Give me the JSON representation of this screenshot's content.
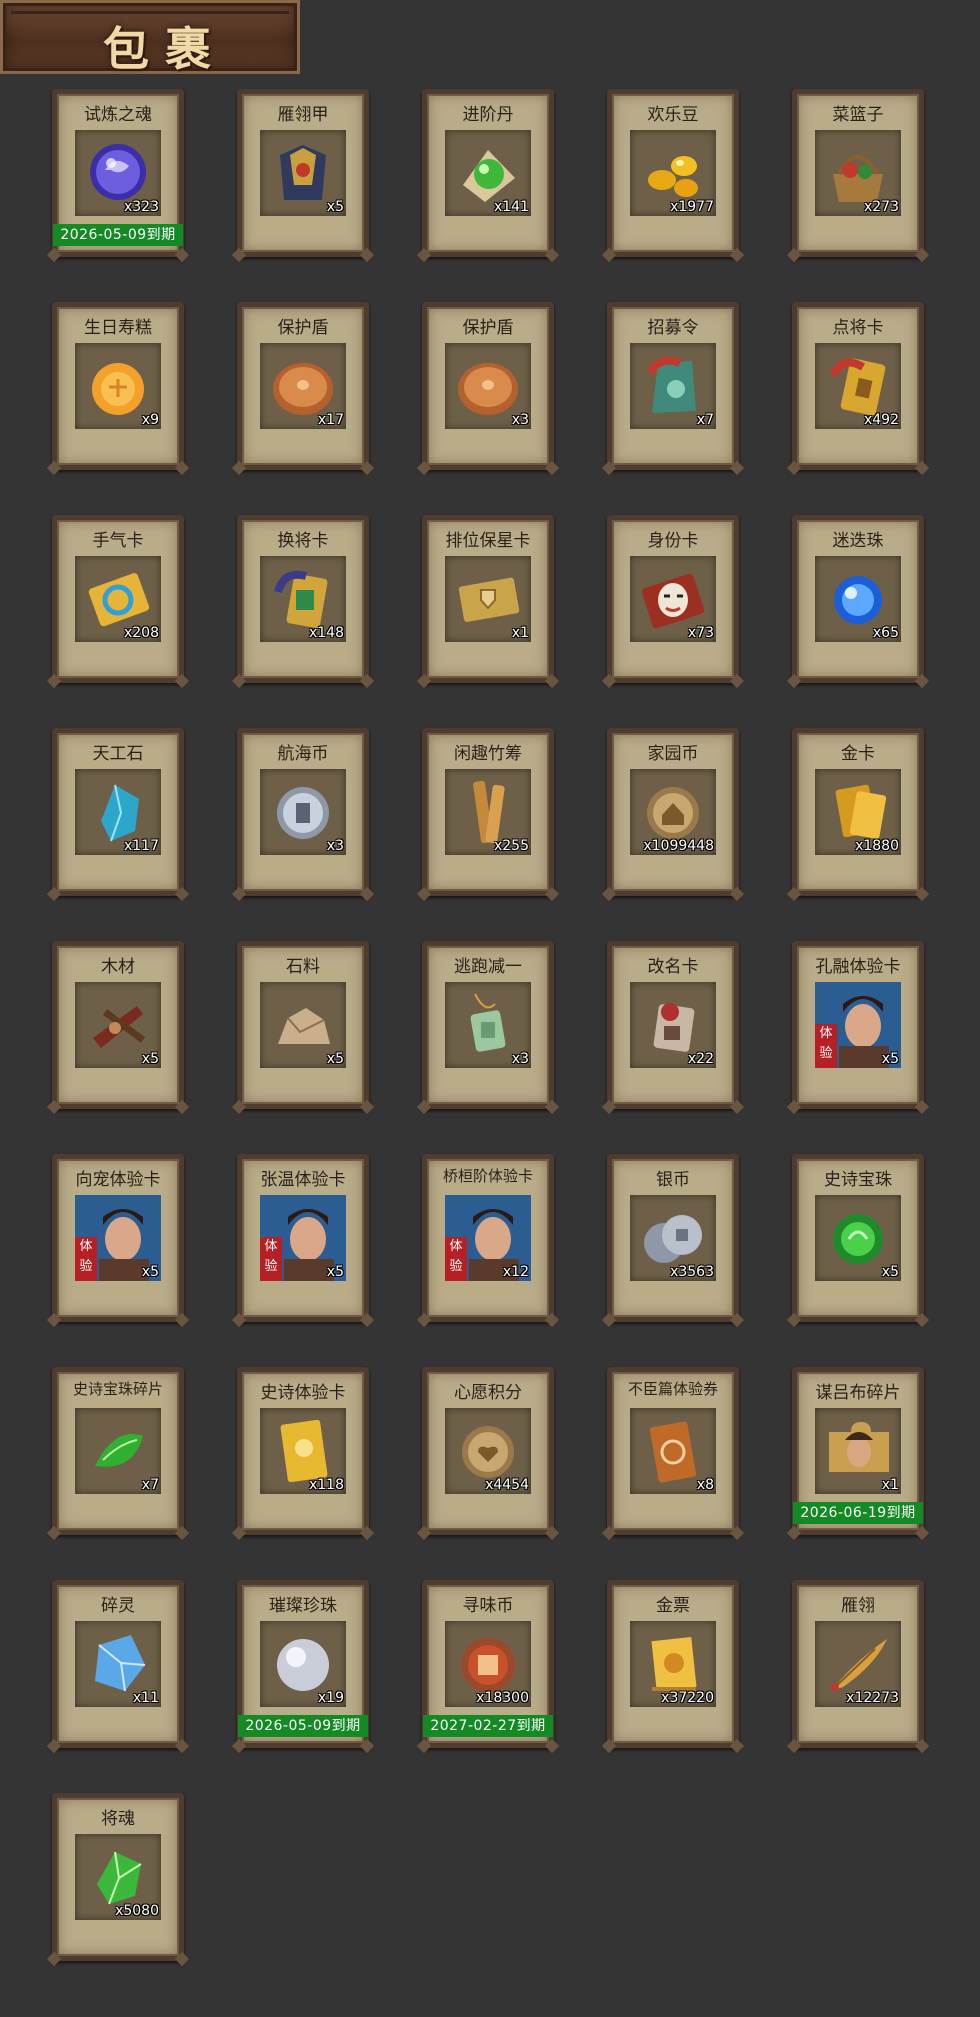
{
  "title": "包裹",
  "items": [
    {
      "name": "试炼之魂",
      "count": "x323",
      "icon": "soul-orb-icon",
      "expiry": "2026-05-09到期"
    },
    {
      "name": "雁翎甲",
      "count": "x5",
      "icon": "armor-icon"
    },
    {
      "name": "进阶丹",
      "count": "x141",
      "icon": "green-pill-icon"
    },
    {
      "name": "欢乐豆",
      "count": "x1977",
      "icon": "beans-icon"
    },
    {
      "name": "菜篮子",
      "count": "x273",
      "icon": "basket-icon"
    },
    {
      "name": "生日寿糕",
      "count": "x9",
      "icon": "mooncake-icon"
    },
    {
      "name": "保护盾",
      "count": "x17",
      "icon": "shield-icon"
    },
    {
      "name": "保护盾",
      "count": "x3",
      "icon": "shield-icon"
    },
    {
      "name": "招募令",
      "count": "x7",
      "icon": "recruit-token-icon"
    },
    {
      "name": "点将卡",
      "count": "x492",
      "icon": "general-card-icon"
    },
    {
      "name": "手气卡",
      "count": "x208",
      "icon": "luck-card-icon"
    },
    {
      "name": "换将卡",
      "count": "x148",
      "icon": "swap-card-icon"
    },
    {
      "name": "排位保星卡",
      "count": "x1",
      "icon": "rank-card-icon"
    },
    {
      "name": "身份卡",
      "count": "x73",
      "icon": "mask-card-icon"
    },
    {
      "name": "迷迭珠",
      "count": "x65",
      "icon": "blue-orb-icon"
    },
    {
      "name": "天工石",
      "count": "x117",
      "icon": "crystal-icon"
    },
    {
      "name": "航海币",
      "count": "x3",
      "icon": "silver-coin-icon"
    },
    {
      "name": "闲趣竹筹",
      "count": "x255",
      "icon": "bamboo-tally-icon"
    },
    {
      "name": "家园币",
      "count": "x1099448",
      "icon": "home-coin-icon"
    },
    {
      "name": "金卡",
      "count": "x1880",
      "icon": "gold-card-icon"
    },
    {
      "name": "木材",
      "count": "x5",
      "icon": "wood-icon"
    },
    {
      "name": "石料",
      "count": "x5",
      "icon": "stone-icon"
    },
    {
      "name": "逃跑减一",
      "count": "x3",
      "icon": "jade-tag-icon"
    },
    {
      "name": "改名卡",
      "count": "x22",
      "icon": "rename-card-icon"
    },
    {
      "name": "孔融体验卡",
      "count": "x5",
      "icon": "portrait-icon",
      "badge": "体验"
    },
    {
      "name": "向宠体验卡",
      "count": "x5",
      "icon": "portrait-icon",
      "badge": "体验"
    },
    {
      "name": "张温体验卡",
      "count": "x5",
      "icon": "portrait-icon",
      "badge": "体验"
    },
    {
      "name": "桥桓阶体验卡",
      "count": "x12",
      "icon": "portrait-icon",
      "badge": "体验"
    },
    {
      "name": "银币",
      "count": "x3563",
      "icon": "silver-coins-icon"
    },
    {
      "name": "史诗宝珠",
      "count": "x5",
      "icon": "green-orb-icon"
    },
    {
      "name": "史诗宝珠碎片",
      "count": "x7",
      "icon": "green-shard-icon"
    },
    {
      "name": "史诗体验卡",
      "count": "x118",
      "icon": "gold-ticket-icon"
    },
    {
      "name": "心愿积分",
      "count": "x4454",
      "icon": "heart-coin-icon"
    },
    {
      "name": "不臣篇体验券",
      "count": "x8",
      "icon": "coupon-icon"
    },
    {
      "name": "谋吕布碎片",
      "count": "x1",
      "icon": "puzzle-piece-icon",
      "expiry": "2026-06-19到期"
    },
    {
      "name": "碎灵",
      "count": "x11",
      "icon": "ice-shard-icon"
    },
    {
      "name": "璀璨珍珠",
      "count": "x19",
      "icon": "pearl-icon",
      "expiry": "2026-05-09到期"
    },
    {
      "name": "寻味币",
      "count": "x18300",
      "icon": "taste-coin-icon",
      "expiry": "2027-02-27到期"
    },
    {
      "name": "金票",
      "count": "x37220",
      "icon": "gold-scroll-icon"
    },
    {
      "name": "雁翎",
      "count": "x12273",
      "icon": "feather-icon"
    },
    {
      "name": "将魂",
      "count": "x5080",
      "icon": "green-gem-icon"
    }
  ],
  "colors": {
    "background": "#343434",
    "card": "#b9ac89",
    "expiry": "#138a24",
    "badge": "#b52025"
  }
}
